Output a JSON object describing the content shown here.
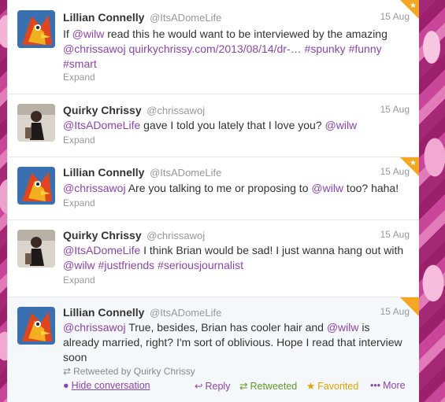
{
  "tweets": [
    {
      "fullname": "Lillian Connelly",
      "username": "@ItsADomeLife",
      "date": "15 Aug",
      "segments": [
        {
          "t": "If ",
          "k": "plain"
        },
        {
          "t": "@wilw",
          "k": "link"
        },
        {
          "t": " read this he would want to be interviewed by the amazing ",
          "k": "plain"
        },
        {
          "t": "@chrissawoj",
          "k": "link"
        },
        {
          "t": " ",
          "k": "plain"
        },
        {
          "t": "quirkychrissy.com/2013/08/14/dr-…",
          "k": "link"
        },
        {
          "t": " ",
          "k": "plain"
        },
        {
          "t": "#spunky",
          "k": "link"
        },
        {
          "t": " ",
          "k": "plain"
        },
        {
          "t": "#funny",
          "k": "link"
        },
        {
          "t": " ",
          "k": "plain"
        },
        {
          "t": "#smart",
          "k": "link"
        }
      ],
      "expand": "Expand"
    },
    {
      "fullname": "Quirky Chrissy",
      "username": "@chrissawoj",
      "date": "15 Aug",
      "segments": [
        {
          "t": "@ItsADomeLife",
          "k": "link"
        },
        {
          "t": " gave I told you lately that I love you? ",
          "k": "plain"
        },
        {
          "t": "@wilw",
          "k": "link"
        }
      ],
      "expand": "Expand"
    },
    {
      "fullname": "Lillian Connelly",
      "username": "@ItsADomeLife",
      "date": "15 Aug",
      "segments": [
        {
          "t": "@chrissawoj",
          "k": "link"
        },
        {
          "t": " Are you talking to me or proposing to ",
          "k": "plain"
        },
        {
          "t": "@wilw",
          "k": "link"
        },
        {
          "t": " too? haha!",
          "k": "plain"
        }
      ],
      "expand": "Expand"
    },
    {
      "fullname": "Quirky Chrissy",
      "username": "@chrissawoj",
      "date": "15 Aug",
      "segments": [
        {
          "t": "@ItsADomeLife",
          "k": "link"
        },
        {
          "t": " I think Brian would be sad! I just wanna hang out with ",
          "k": "plain"
        },
        {
          "t": "@wilw",
          "k": "link"
        },
        {
          "t": " ",
          "k": "plain"
        },
        {
          "t": "#justfriends",
          "k": "link"
        },
        {
          "t": " ",
          "k": "plain"
        },
        {
          "t": "#seriousjournalist",
          "k": "link"
        }
      ],
      "expand": "Expand"
    },
    {
      "fullname": "Lillian Connelly",
      "username": "@ItsADomeLife",
      "date": "15 Aug",
      "segments": [
        {
          "t": "@chrissawoj",
          "k": "link"
        },
        {
          "t": " True, besides, Brian has cooler hair and ",
          "k": "plain"
        },
        {
          "t": "@wilw",
          "k": "link"
        },
        {
          "t": " is already married, right? I'm sort of oblivious. Hope I read that interview soon",
          "k": "plain"
        }
      ],
      "retweeted_by": "Retweeted by Quirky Chrissy",
      "actions": {
        "hide": "Hide conversation",
        "reply": "Reply",
        "retweeted": "Retweeted",
        "favorited": "Favorited",
        "more": "More"
      }
    }
  ],
  "colors": {
    "link": "#8e44ad",
    "retweet": "#609928",
    "favorite": "#e5a000",
    "corner": "#f5a623"
  },
  "icons": {
    "reply": "reply-icon",
    "retweet": "retweet-icon",
    "favorite": "star-icon",
    "more": "more-icon",
    "hide": "speech-bubble-icon"
  }
}
